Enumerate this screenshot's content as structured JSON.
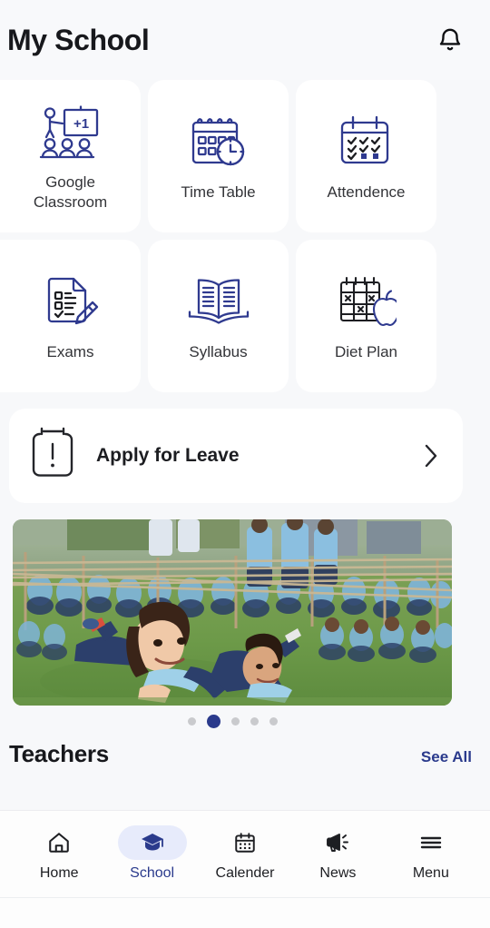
{
  "header": {
    "title": "My School",
    "notification_icon": "bell-icon"
  },
  "grid": {
    "rows": [
      [
        {
          "label": "Google Classroom",
          "icon": "teacher-whiteboard-icon",
          "badge": "+1"
        },
        {
          "label": "Time Table",
          "icon": "calendar-clock-icon"
        },
        {
          "label": "Attendence",
          "icon": "calendar-checks-icon"
        }
      ],
      [
        {
          "label": "Exams",
          "icon": "document-checklist-pencil-icon"
        },
        {
          "label": "Syllabus",
          "icon": "open-book-icon"
        },
        {
          "label": "Diet Plan",
          "icon": "calendar-apple-icon"
        }
      ]
    ]
  },
  "leave": {
    "title": "Apply for Leave",
    "icon": "clipboard-exclamation-icon",
    "chevron": "chevron-right-icon"
  },
  "carousel": {
    "image_description": "School children in blue uniforms crawling under rope net on grass field",
    "dots": 5,
    "active_dot": 2
  },
  "teachers": {
    "title": "Teachers",
    "see_all": "See All"
  },
  "bottom_nav": {
    "items": [
      {
        "label": "Home",
        "icon": "home-icon",
        "active": false
      },
      {
        "label": "School",
        "icon": "graduation-cap-icon",
        "active": true
      },
      {
        "label": "Calender",
        "icon": "calendar-icon",
        "active": false
      },
      {
        "label": "News",
        "icon": "megaphone-icon",
        "active": false
      },
      {
        "label": "Menu",
        "icon": "hamburger-menu-icon",
        "active": false
      }
    ]
  },
  "colors": {
    "accent_blue": "#2a3a8c",
    "icon_navy": "#2f3a8f",
    "icon_dark": "#24252a",
    "page_bg": "#f7f8fa",
    "card_bg": "#ffffff",
    "active_pill": "#e7ebfb"
  }
}
